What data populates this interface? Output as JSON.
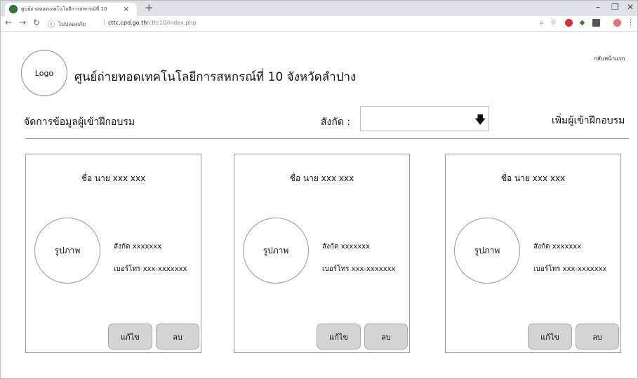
{
  "browser": {
    "tab_title": "ศูนย์ถ่ายทอดเทคโนโลยีการสหกรณ์ที่ 10",
    "tab_close": "×",
    "new_tab": "+",
    "security_label": "ไม่ปลอดภัย",
    "url_host": "cttc.cpd.go.th",
    "url_path": "/cttc10/index.php"
  },
  "header": {
    "logo_text": "Logo",
    "title": "ศูนย์ถ่ายทอดเทคโนโลยีการสหกรณ์ที่ 10 จังหวัดลำปาง",
    "home_link": "กลับหน้าแรก"
  },
  "toolbar": {
    "section_title": "จัดการข้อมูลผู้เข้าฝึกอบรม",
    "affiliation_label": "สังกัด :",
    "affiliation_value": "",
    "add_link": "เพิ่มผู้เข้าฝึกอบรม"
  },
  "cards": [
    {
      "name": "ชื่อ นาย xxx  xxx",
      "photo": "รูปภาพ",
      "affiliation": "สังกัด  xxxxxxx",
      "phone": "เบอร์โทร  xxx-xxxxxxx",
      "edit": "แก้ไข",
      "delete": "ลบ"
    },
    {
      "name": "ชื่อ นาย xxx  xxx",
      "photo": "รูปภาพ",
      "affiliation": "สังกัด  xxxxxxx",
      "phone": "เบอร์โทร  xxx-xxxxxxx",
      "edit": "แก้ไข",
      "delete": "ลบ"
    },
    {
      "name": "ชื่อ นาย xxx  xxx",
      "photo": "รูปภาพ",
      "affiliation": "สังกัด  xxxxxxx",
      "phone": "เบอร์โทร  xxx-xxxxxxx",
      "edit": "แก้ไข",
      "delete": "ลบ"
    }
  ],
  "icons": {
    "back": "back-arrow-icon",
    "forward": "forward-arrow-icon",
    "reload": "reload-icon",
    "info": "info-icon",
    "zoom": "zoom-icon",
    "bookmark": "star-icon",
    "dropdown": "down-arrow-icon",
    "favicon": "green-circle-favicon"
  }
}
